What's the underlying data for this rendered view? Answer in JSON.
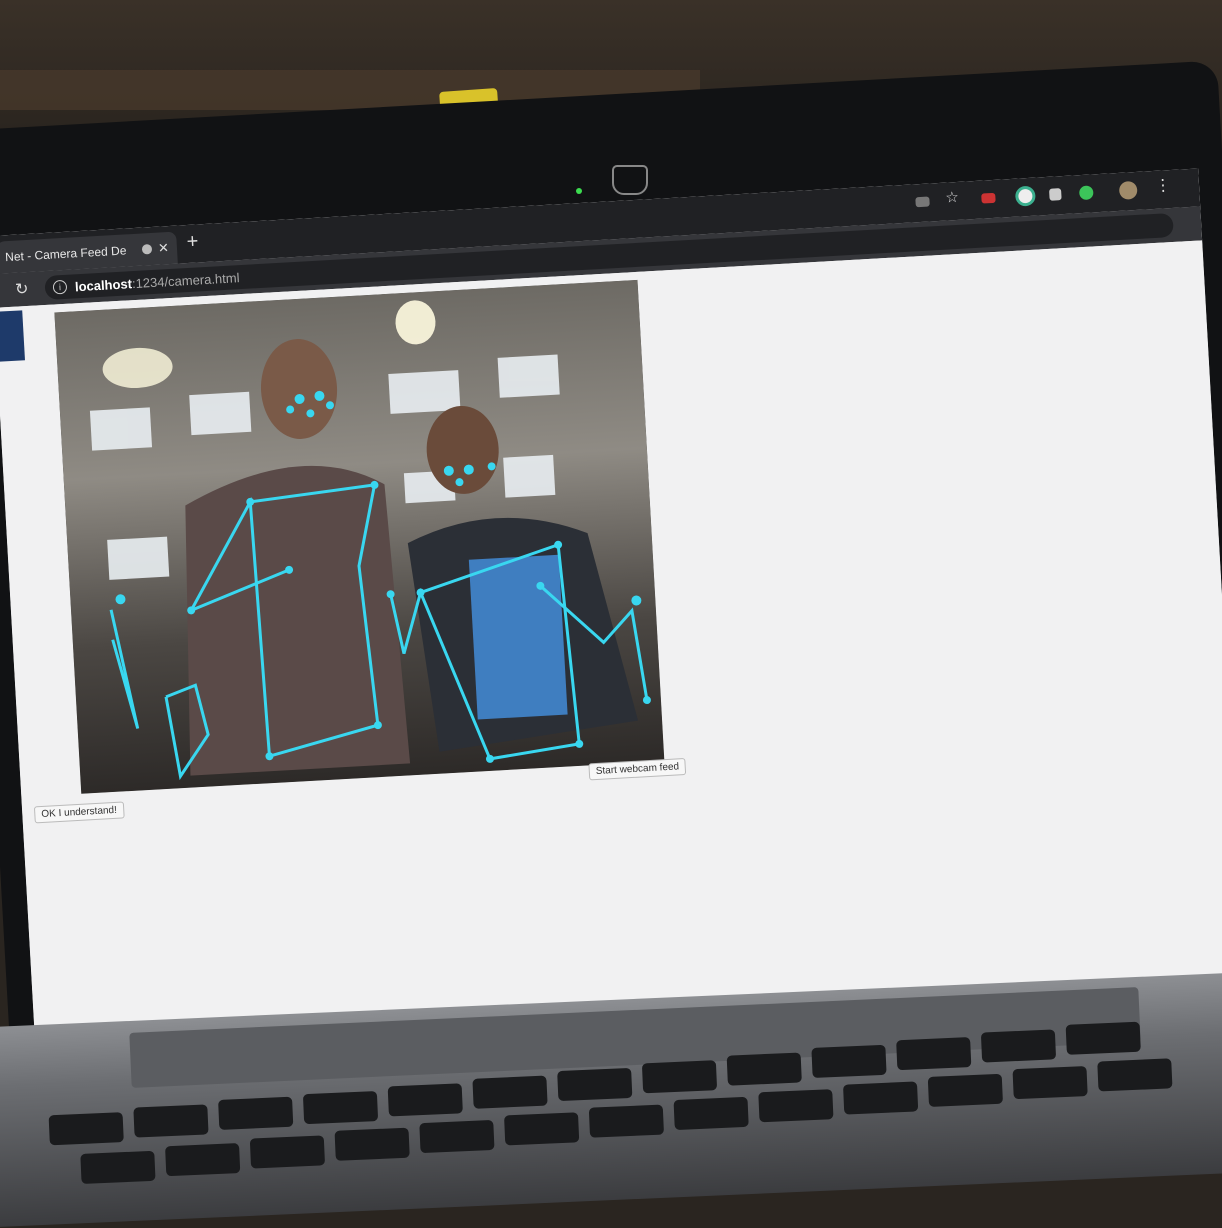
{
  "browser": {
    "tab_title": "Net - Camera Feed De",
    "new_tab": "+",
    "tab_close": "✕",
    "reload": "↻",
    "url_host": "localhost",
    "url_rest": ":1234/camera.html"
  },
  "page": {
    "start_button": "Start webcam feed",
    "ok_button": "OK I understand!"
  },
  "colors": {
    "skeleton": "#39d7f0",
    "browser_chrome": "#35363a"
  },
  "icons": [
    "camera-icon",
    "star-icon",
    "extension-icon",
    "grammarly-icon",
    "profile-avatar-icon",
    "menu-dots-icon"
  ]
}
